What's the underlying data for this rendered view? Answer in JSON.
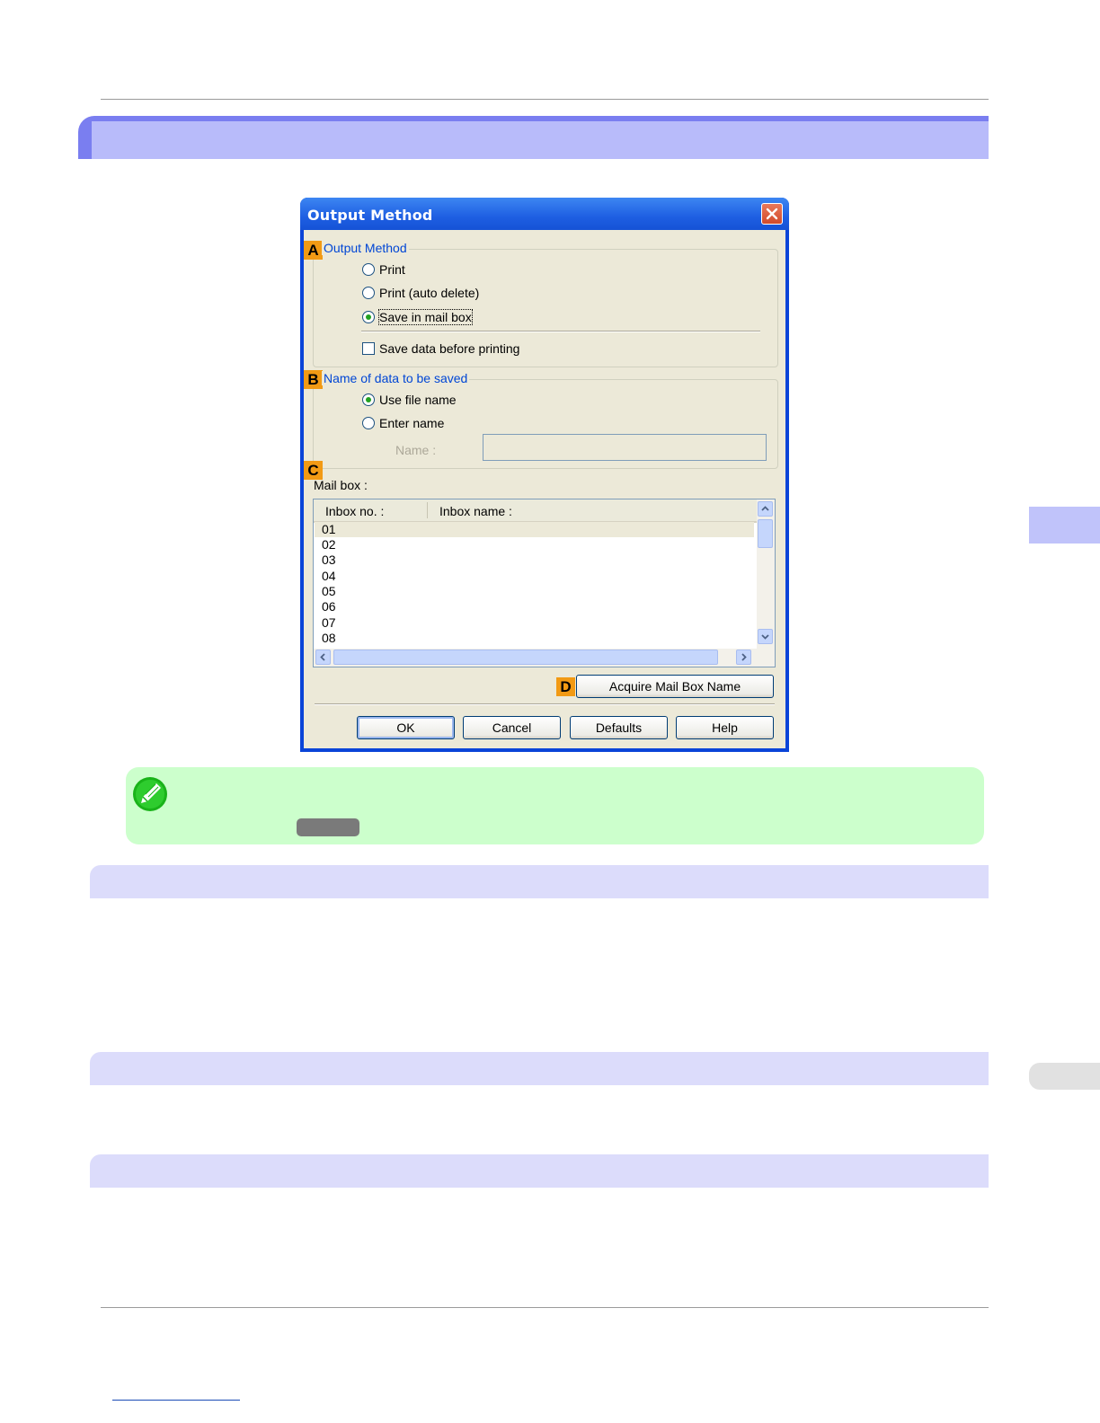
{
  "dialog": {
    "title": "Output Method",
    "group_output_method": {
      "marker": "A",
      "label": "Output Method",
      "options": [
        "Print",
        "Print (auto delete)",
        "Save in mail box"
      ],
      "selected": "Save in mail box",
      "checkbox_label": "Save data before printing",
      "checkbox_checked": false
    },
    "group_name": {
      "marker": "B",
      "label": "Name of data to be saved",
      "options": [
        "Use file name",
        "Enter name"
      ],
      "selected": "Use file name",
      "name_label": "Name :",
      "name_value": ""
    },
    "mailbox": {
      "marker": "C",
      "label": "Mail box :",
      "columns": [
        "Inbox no. :",
        "Inbox name :"
      ],
      "rows": [
        "01",
        "02",
        "03",
        "04",
        "05",
        "06",
        "07",
        "08"
      ],
      "selected_row": "01"
    },
    "acquire": {
      "marker": "D",
      "label": "Acquire Mail Box Name"
    },
    "buttons": {
      "ok": "OK",
      "cancel": "Cancel",
      "defaults": "Defaults",
      "help": "Help"
    }
  },
  "colors": {
    "title_band": "#b8bbfa",
    "note_background": "#ccffcc",
    "section_band": "#dcdcfb",
    "marker": "#f29a14"
  },
  "icons": [
    "close-icon",
    "note-pencil-icon",
    "scroll-up-icon",
    "scroll-down-icon",
    "scroll-left-icon",
    "scroll-right-icon"
  ]
}
